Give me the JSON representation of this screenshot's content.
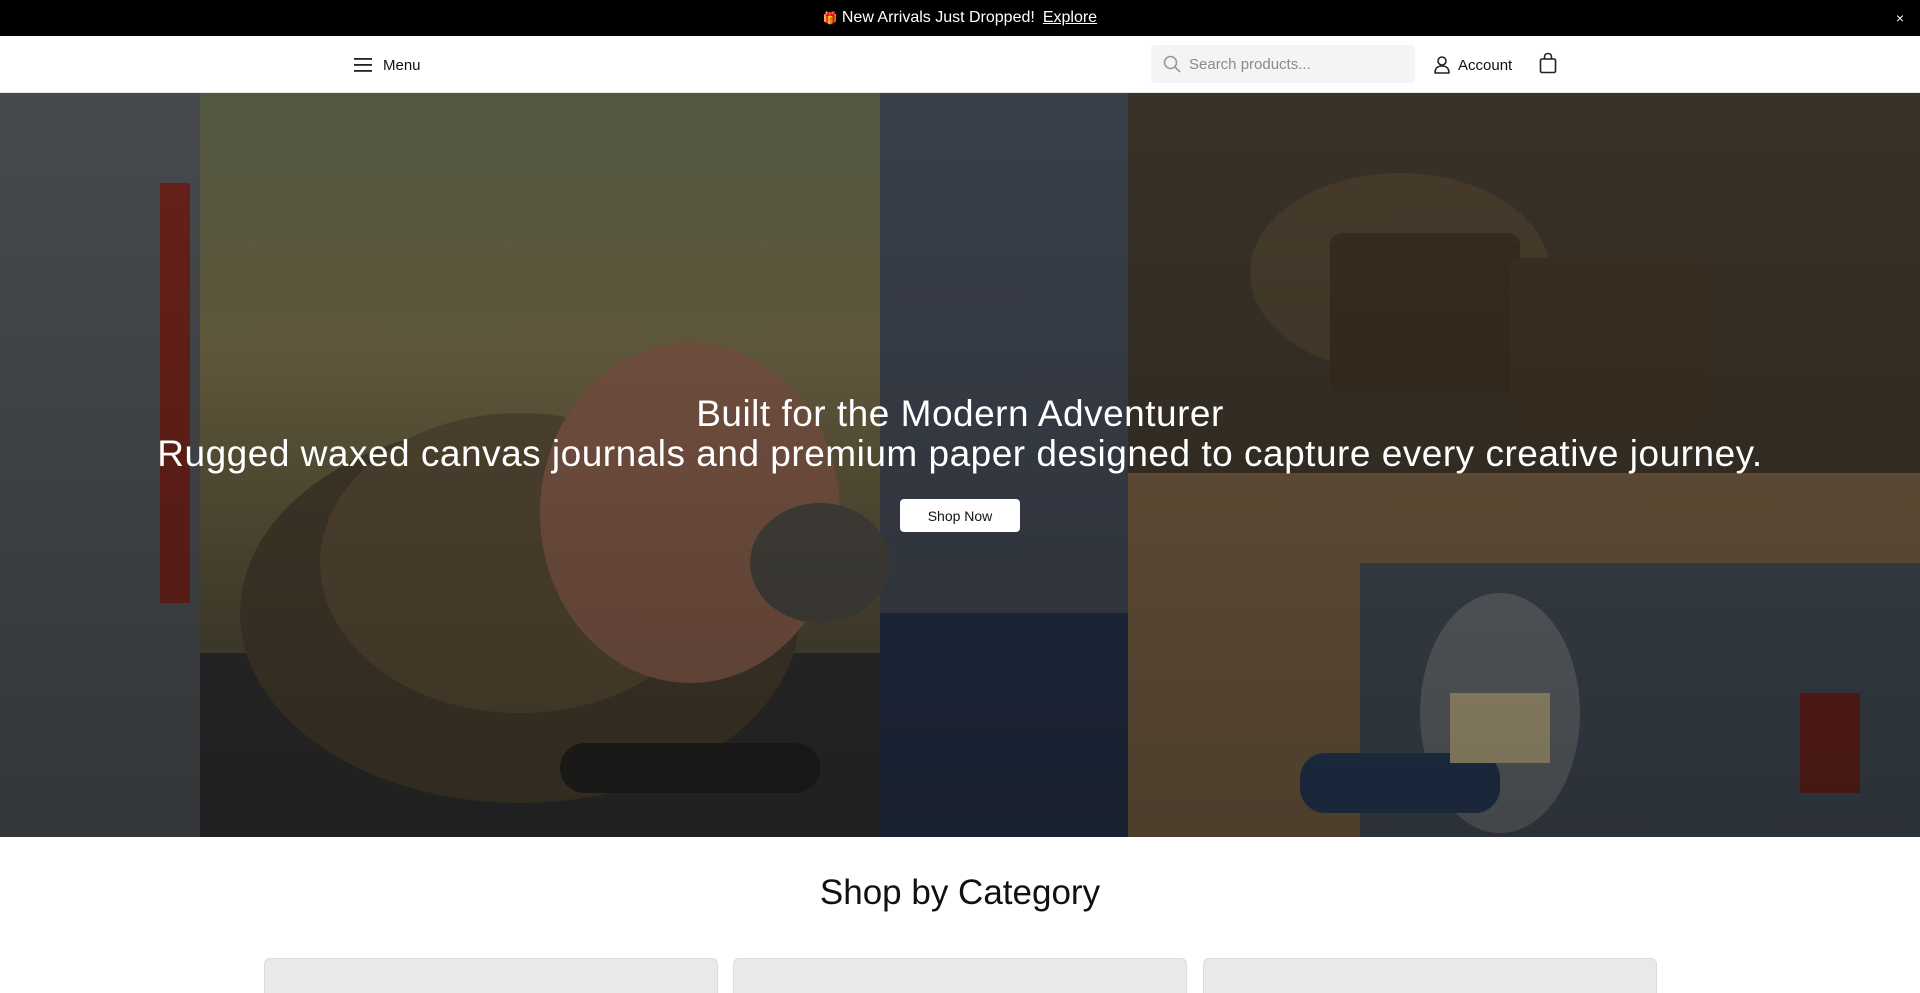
{
  "announcement": {
    "icon": "gift-icon",
    "text": "New Arrivals Just Dropped!",
    "link_label": "Explore",
    "close_label": "×"
  },
  "header": {
    "menu_label": "Menu",
    "search_placeholder": "Search products...",
    "account_label": "Account"
  },
  "hero": {
    "title": "Built for the Modern Adventurer",
    "subtitle": "Rugged waxed canvas journals and premium paper designed to capture every creative journey.",
    "cta_label": "Shop Now"
  },
  "categories": {
    "title": "Shop by Category",
    "cards": 3
  },
  "colors": {
    "announcement_bg": "#000000",
    "accent_text": "#111111",
    "card_bg": "#e9e9e9"
  }
}
